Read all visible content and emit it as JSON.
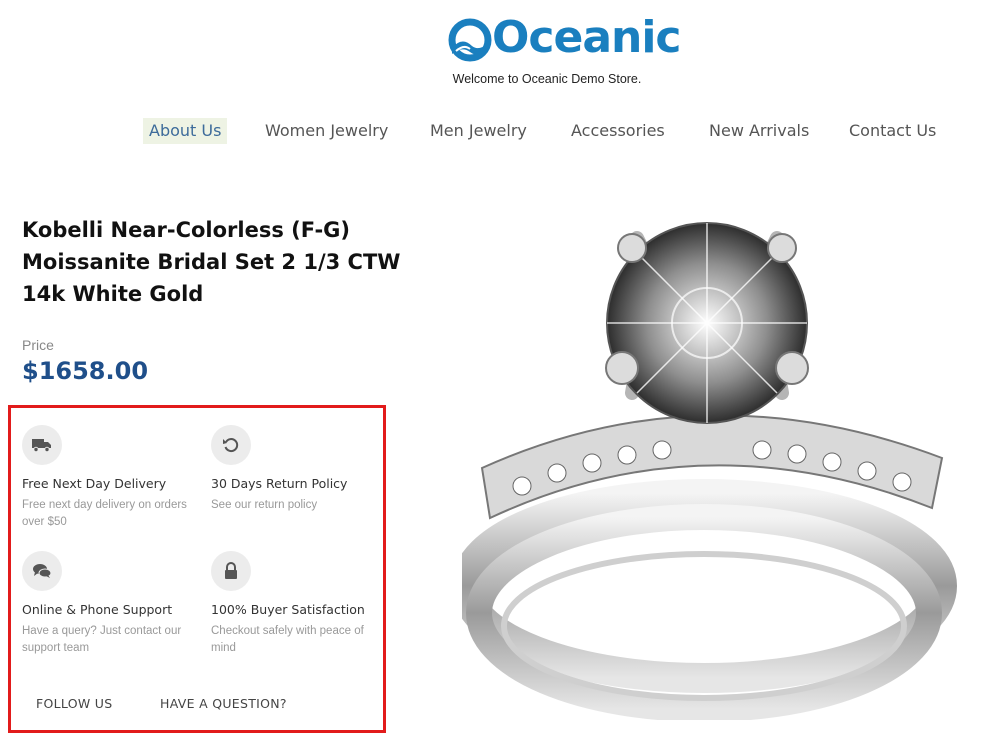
{
  "brand": {
    "name": "Oceanic",
    "tagline": "Welcome to Oceanic Demo Store.",
    "color": "#1a7fbf"
  },
  "nav": {
    "items": [
      {
        "label": "About Us",
        "active": true
      },
      {
        "label": "Women Jewelry",
        "active": false
      },
      {
        "label": "Men Jewelry",
        "active": false
      },
      {
        "label": "Accessories",
        "active": false
      },
      {
        "label": "New Arrivals",
        "active": false
      },
      {
        "label": "Contact Us",
        "active": false
      }
    ]
  },
  "product": {
    "title": "Kobelli Near-Colorless (F-G) Moissanite Bridal Set 2 1/3 CTW 14k White Gold",
    "price_label": "Price",
    "price": "$1658.00",
    "price_color": "#1f4f8a"
  },
  "features": [
    {
      "icon": "truck-icon",
      "title": "Free Next Day Delivery",
      "desc": "Free next day delivery on orders over $50"
    },
    {
      "icon": "undo-icon",
      "title": "30 Days Return Policy",
      "desc": "See our return policy"
    },
    {
      "icon": "chat-icon",
      "title": "Online & Phone Support",
      "desc": "Have a query? Just contact our support team"
    },
    {
      "icon": "lock-icon",
      "title": "100% Buyer Satisfaction",
      "desc": "Checkout safely with peace of mind"
    }
  ],
  "links": {
    "follow": "FOLLOW US",
    "question": "HAVE A QUESTION?"
  },
  "highlight_color": "#e21b1b"
}
